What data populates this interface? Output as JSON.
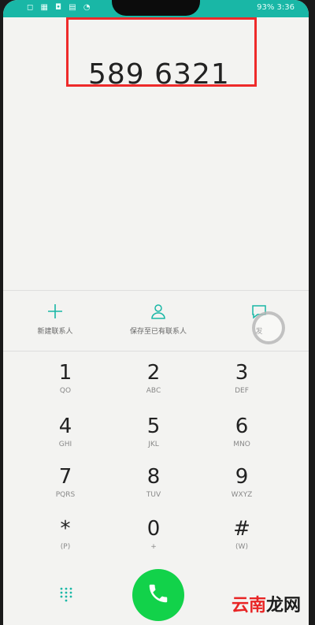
{
  "status_bar": {
    "left": "◻ ▦ ◘ ▤ ◔",
    "right": "93% 3:36"
  },
  "dialer": {
    "number": "589 6321"
  },
  "actions": [
    {
      "label": "新建联系人"
    },
    {
      "label": "保存至已有联系人"
    },
    {
      "label": "发"
    }
  ],
  "keypad": [
    {
      "digit": "1",
      "letters": "QO"
    },
    {
      "digit": "2",
      "letters": "ABC"
    },
    {
      "digit": "3",
      "letters": "DEF"
    },
    {
      "digit": "4",
      "letters": "GHI"
    },
    {
      "digit": "5",
      "letters": "JKL"
    },
    {
      "digit": "6",
      "letters": "MNO"
    },
    {
      "digit": "7",
      "letters": "PQRS"
    },
    {
      "digit": "8",
      "letters": "TUV"
    },
    {
      "digit": "9",
      "letters": "WXYZ"
    },
    {
      "digit": "*",
      "letters": "(P)"
    },
    {
      "digit": "0",
      "letters": "+"
    },
    {
      "digit": "#",
      "letters": "(W)"
    }
  ],
  "watermark": {
    "part1": "云南",
    "part2": "龙网"
  },
  "colors": {
    "accent": "#19b7a6",
    "call": "#12d24a",
    "highlight": "#ee2a2a"
  }
}
